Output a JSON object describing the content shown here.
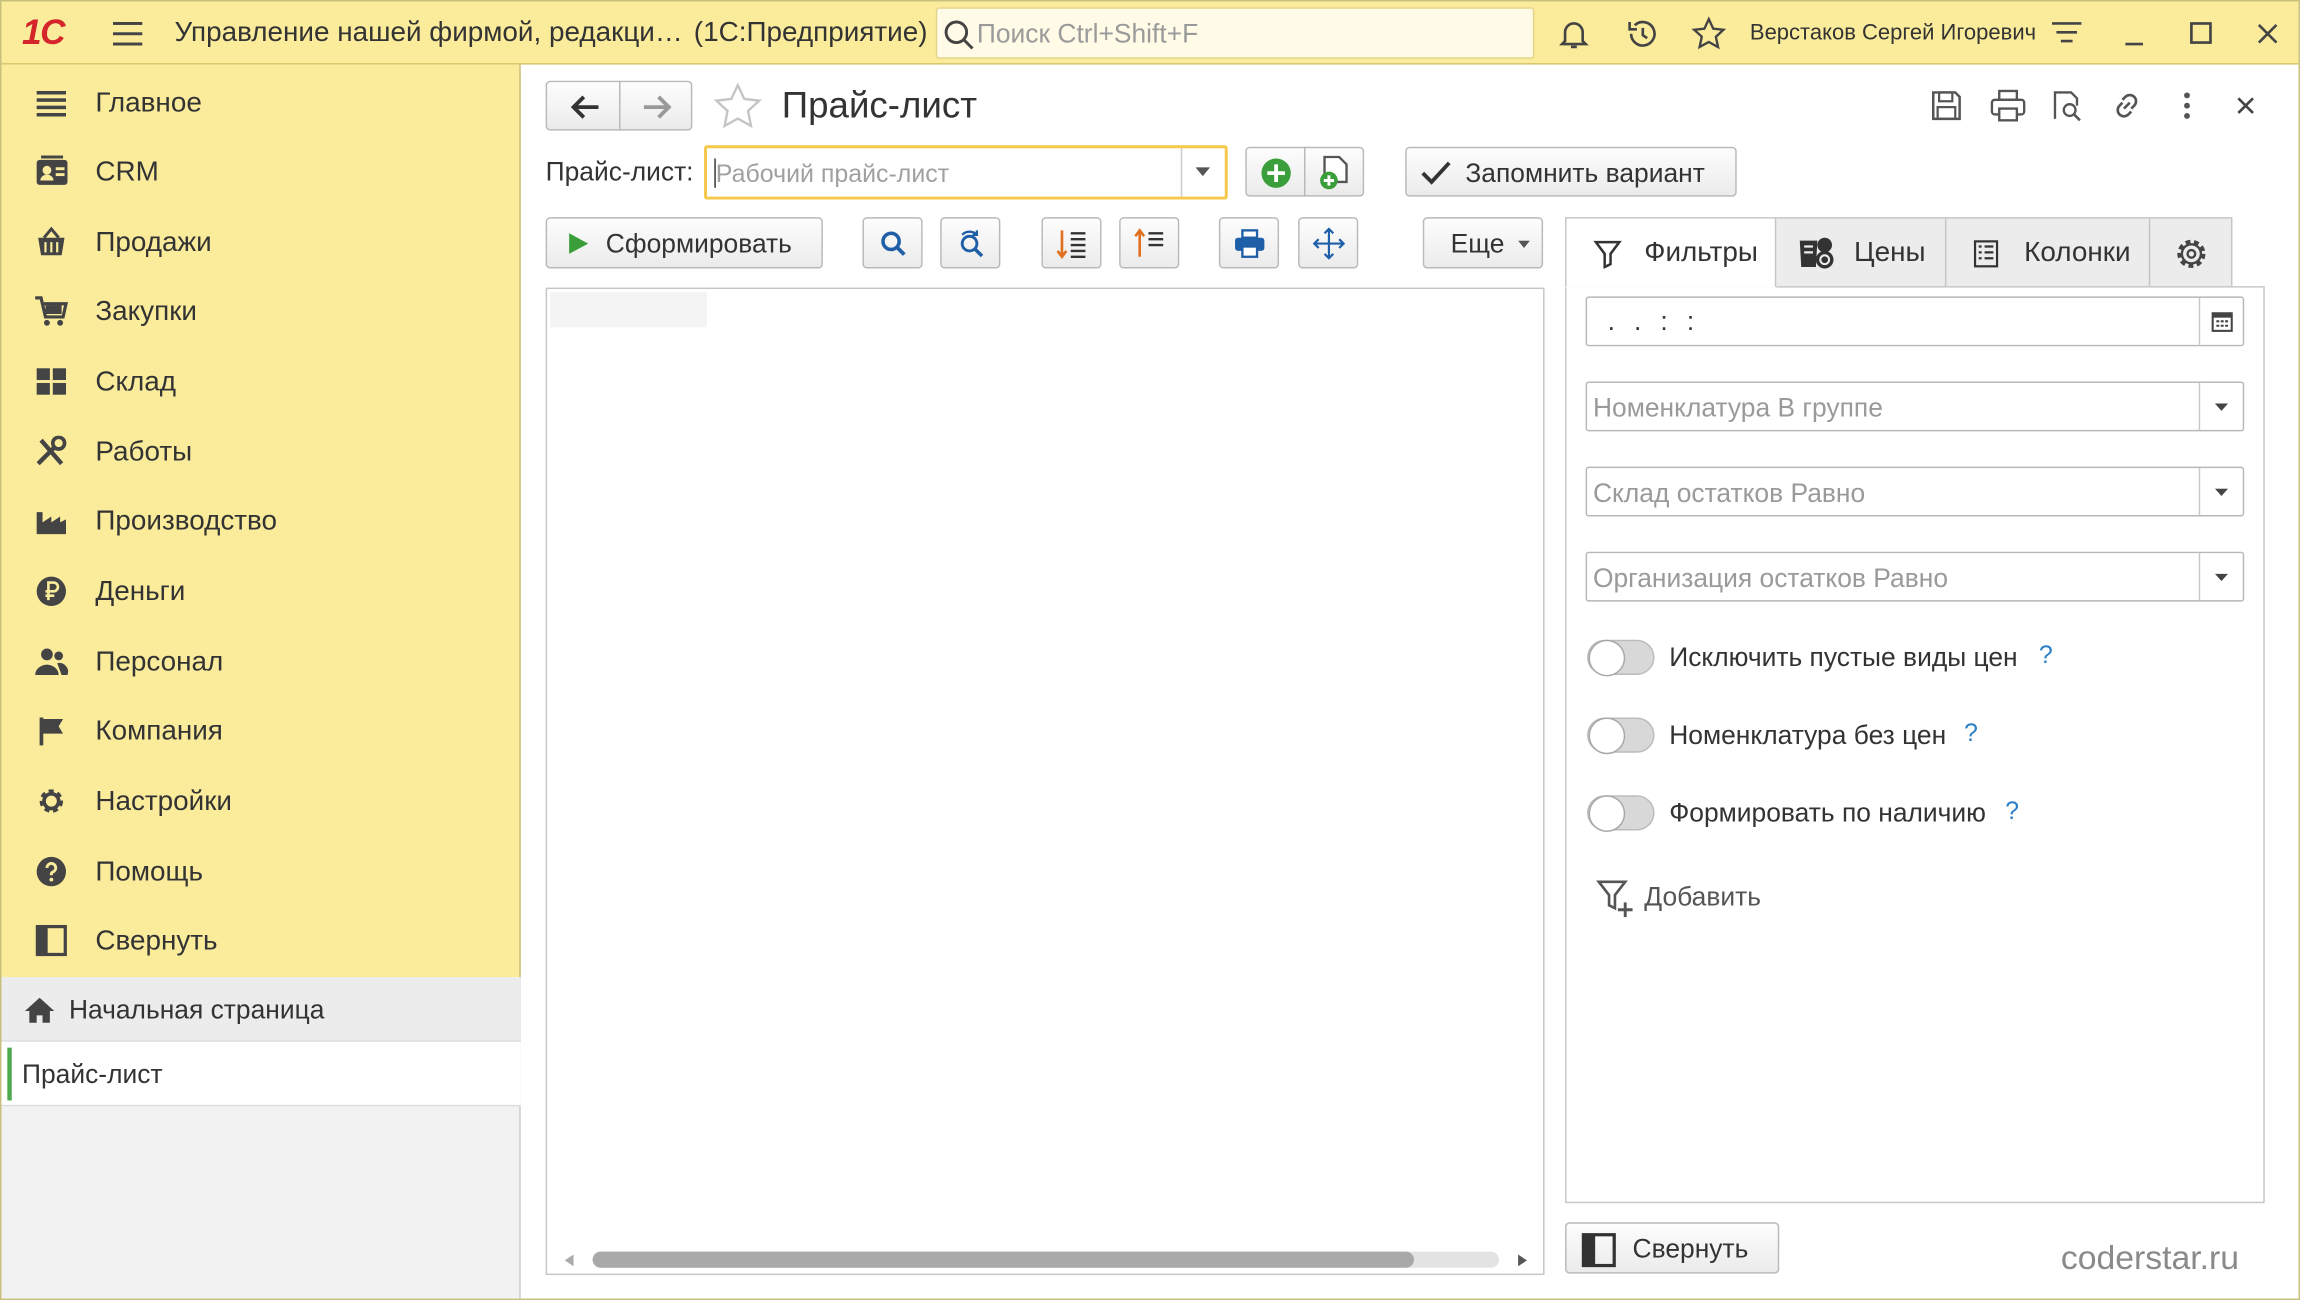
{
  "titlebar": {
    "logo": "1С",
    "app_title": "Управление нашей фирмой, редакци…",
    "app_suffix": "(1С:Предприятие)",
    "search_placeholder": "Поиск Ctrl+Shift+F",
    "user": "Верстаков Сергей Игоревич"
  },
  "sidebar": {
    "items": [
      {
        "label": "Главное",
        "icon": "menu-icon"
      },
      {
        "label": "CRM",
        "icon": "crm-icon"
      },
      {
        "label": "Продажи",
        "icon": "basket-icon"
      },
      {
        "label": "Закупки",
        "icon": "cart-icon"
      },
      {
        "label": "Склад",
        "icon": "warehouse-icon"
      },
      {
        "label": "Работы",
        "icon": "tools-icon"
      },
      {
        "label": "Производство",
        "icon": "factory-icon"
      },
      {
        "label": "Деньги",
        "icon": "ruble-icon"
      },
      {
        "label": "Персонал",
        "icon": "people-icon"
      },
      {
        "label": "Компания",
        "icon": "flag-icon"
      },
      {
        "label": "Настройки",
        "icon": "gear-icon"
      },
      {
        "label": "Помощь",
        "icon": "help-icon"
      },
      {
        "label": "Свернуть",
        "icon": "collapse-icon"
      }
    ]
  },
  "open_pages": {
    "home": "Начальная страница",
    "current": "Прайс-лист"
  },
  "form": {
    "title": "Прайс-лист",
    "pricelist_label": "Прайс-лист:",
    "pricelist_placeholder": "Рабочий прайс-лист",
    "remember_label": "Запомнить вариант",
    "generate_label": "Сформировать",
    "more_label": "Еще"
  },
  "panel": {
    "tabs": {
      "filters": "Фильтры",
      "prices": "Цены",
      "columns": "Колонки"
    },
    "date_value": ". .   : :",
    "fields": [
      {
        "placeholder": "Номенклатура В группе"
      },
      {
        "placeholder": "Склад остатков Равно"
      },
      {
        "placeholder": "Организация остатков Равно"
      }
    ],
    "toggles": [
      {
        "label": "Исключить пустые виды цен",
        "on": false
      },
      {
        "label": "Номенклатура без цен",
        "on": false
      },
      {
        "label": "Формировать по наличию",
        "on": false
      }
    ],
    "help_mark": "?",
    "add_label": "Добавить",
    "collapse_label": "Свернуть"
  },
  "watermark": "coderstar.ru",
  "colors": {
    "accent": "#fbec9c",
    "brand_red": "#d4252b",
    "focus": "#f5c84a",
    "link": "#2a7fc7"
  }
}
